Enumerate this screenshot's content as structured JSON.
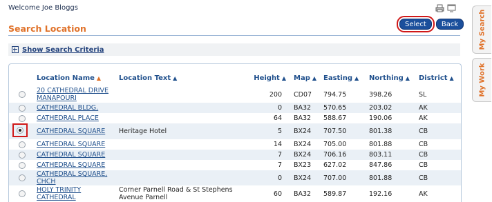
{
  "header": {
    "welcome": "Welcome Joe Bloggs",
    "icons": [
      "print-icon",
      "window-icon"
    ]
  },
  "page": {
    "title": "Search Location"
  },
  "buttons": {
    "select": "Select",
    "back": "Back"
  },
  "criteria": {
    "label": "Show Search Criteria"
  },
  "table": {
    "columns": [
      {
        "label": "Location Name",
        "sorted": true
      },
      {
        "label": "Location Text"
      },
      {
        "label": "Height"
      },
      {
        "label": "Map"
      },
      {
        "label": "Easting"
      },
      {
        "label": "Northing"
      },
      {
        "label": "District"
      }
    ],
    "rows": [
      {
        "name": "20 CATHEDRAL DRIVE MANAPOURI",
        "text": "",
        "height": "200",
        "map": "CD07",
        "easting": "794.75",
        "northing": "398.26",
        "district": "SL",
        "selected": false
      },
      {
        "name": "CATHEDRAL BLDG.",
        "text": "",
        "height": "0",
        "map": "BA32",
        "easting": "570.65",
        "northing": "203.02",
        "district": "AK",
        "selected": false
      },
      {
        "name": "CATHEDRAL PLACE",
        "text": "",
        "height": "64",
        "map": "BA32",
        "easting": "588.67",
        "northing": "190.06",
        "district": "AK",
        "selected": false
      },
      {
        "name": "CATHEDRAL SQUARE",
        "text": "Heritage Hotel",
        "height": "5",
        "map": "BX24",
        "easting": "707.50",
        "northing": "801.38",
        "district": "CB",
        "selected": true
      },
      {
        "name": "CATHEDRAL SQUARE",
        "text": "",
        "height": "14",
        "map": "BX24",
        "easting": "705.00",
        "northing": "801.88",
        "district": "CB",
        "selected": false
      },
      {
        "name": "CATHEDRAL SQUARE",
        "text": "",
        "height": "7",
        "map": "BX24",
        "easting": "706.16",
        "northing": "803.11",
        "district": "CB",
        "selected": false
      },
      {
        "name": "CATHEDRAL SQUARE",
        "text": "",
        "height": "7",
        "map": "BX23",
        "easting": "627.02",
        "northing": "847.86",
        "district": "CB",
        "selected": false
      },
      {
        "name": "CATHEDRAL SQUARE, CHCH",
        "text": "",
        "height": "0",
        "map": "BX24",
        "easting": "707.00",
        "northing": "801.88",
        "district": "CB",
        "selected": false
      },
      {
        "name": "HOLY TRINITY CATHEDRAL",
        "text": "Corner Parnell Road & St Stephens Avenue Parnell",
        "height": "60",
        "map": "BA32",
        "easting": "589.87",
        "northing": "192.16",
        "district": "AK",
        "selected": false
      }
    ]
  },
  "side_tabs": {
    "search": "My Search",
    "work": "My Work"
  }
}
